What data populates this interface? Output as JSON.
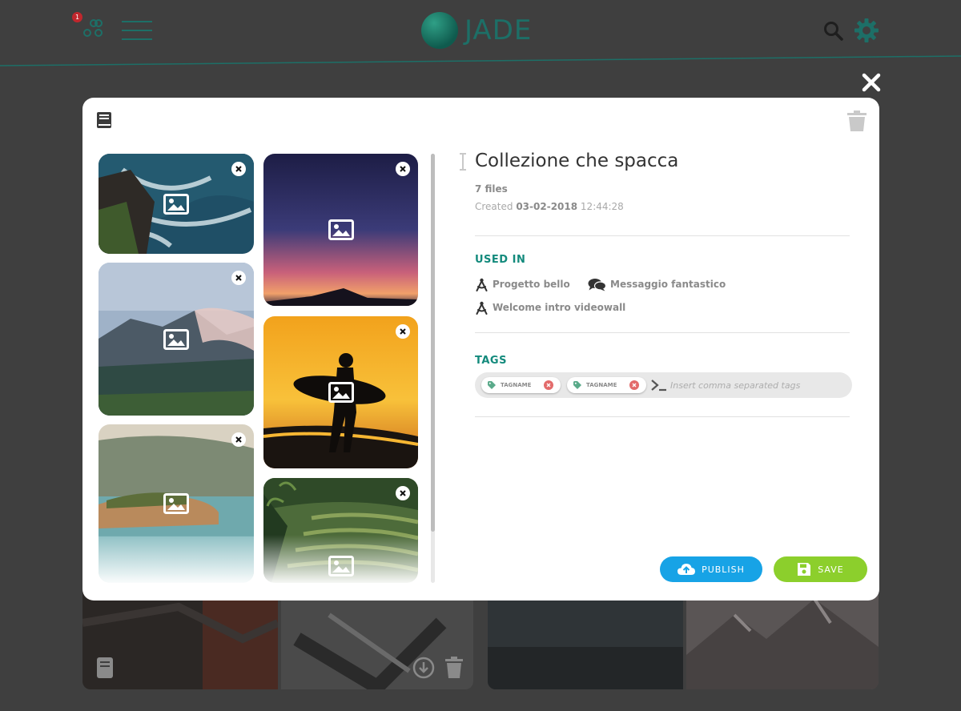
{
  "app": {
    "name": "JADE",
    "notification_count": "1"
  },
  "modal": {
    "title": "Collezione che spacca",
    "files_count": "7 files",
    "created_label": "Created",
    "created_date": "03-02-2018",
    "created_time": "12:44:28",
    "used_in": {
      "title": "USED IN",
      "items": [
        {
          "label": "Progetto bello",
          "icon": "compass-icon"
        },
        {
          "label": "Messaggio fantastico",
          "icon": "chat-bubbles-icon"
        },
        {
          "label": "Welcome intro videowall",
          "icon": "compass-icon"
        }
      ]
    },
    "tags": {
      "title": "TAGS",
      "items": [
        "TAGNAME",
        "TAGNAME"
      ],
      "placeholder": "Insert comma separated tags"
    },
    "buttons": {
      "publish": "PUBLISH",
      "save": "SAVE"
    }
  },
  "colors": {
    "brand": "#1d6f67",
    "accent": "#138a7c",
    "publish": "#17a3e6",
    "save": "#8ccf2c",
    "tag_remove": "#e36b6b"
  }
}
